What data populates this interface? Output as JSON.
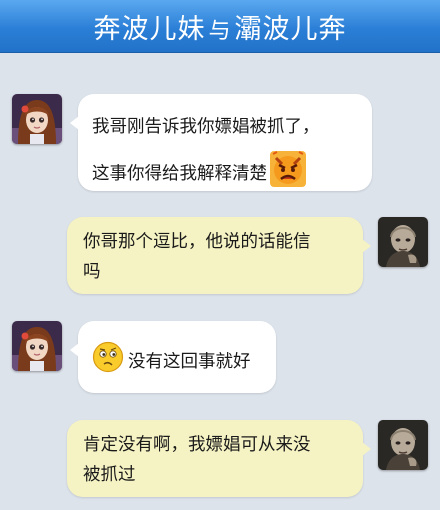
{
  "header": {
    "title_left": "奔波儿妹",
    "title_sep": "与",
    "title_right": "灞波儿奔"
  },
  "messages": [
    {
      "side": "incoming",
      "avatar": "girl-avatar",
      "lines": [
        "我哥刚告诉我你嫖娼被抓了，",
        "这事你得给我解释清楚"
      ],
      "emoji": "angry-face-icon"
    },
    {
      "side": "outgoing",
      "avatar": "bald-man-avatar",
      "lines": [
        "你哥那个逗比，他说的话能信",
        "吗"
      ]
    },
    {
      "side": "incoming",
      "avatar": "girl-avatar",
      "lines": [
        "没有这回事就好"
      ],
      "emoji": "confused-face-icon"
    },
    {
      "side": "outgoing",
      "avatar": "bald-man-avatar",
      "lines": [
        "肯定没有啊，我嫖娼可从来没",
        "被抓过"
      ]
    }
  ]
}
